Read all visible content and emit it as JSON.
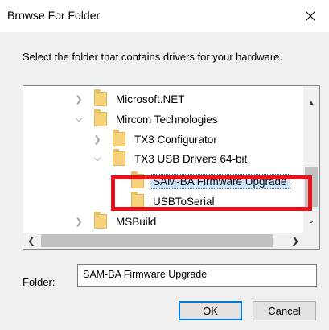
{
  "window": {
    "title": "Browse For Folder"
  },
  "instruction": "Select the folder that contains drivers for your hardware.",
  "tree": {
    "items": [
      {
        "label": "Microsoft.NET",
        "expander": "collapsed"
      },
      {
        "label": "Mircom Technologies",
        "expander": "expanded"
      },
      {
        "label": "TX3 Configurator",
        "expander": "collapsed"
      },
      {
        "label": "TX3 USB Drivers 64-bit",
        "expander": "expanded"
      },
      {
        "label": "SAM-BA Firmware Upgrade",
        "expander": "none",
        "selected": true
      },
      {
        "label": "USBToSerial",
        "expander": "none"
      },
      {
        "label": "MSBuild",
        "expander": "collapsed"
      }
    ]
  },
  "folder_field": {
    "label": "Folder:",
    "value": "SAM-BA Firmware Upgrade"
  },
  "buttons": {
    "ok": "OK",
    "cancel": "Cancel"
  },
  "colors": {
    "highlight": "#e8141b",
    "selection": "#cce8ff",
    "accent": "#0078d7"
  }
}
